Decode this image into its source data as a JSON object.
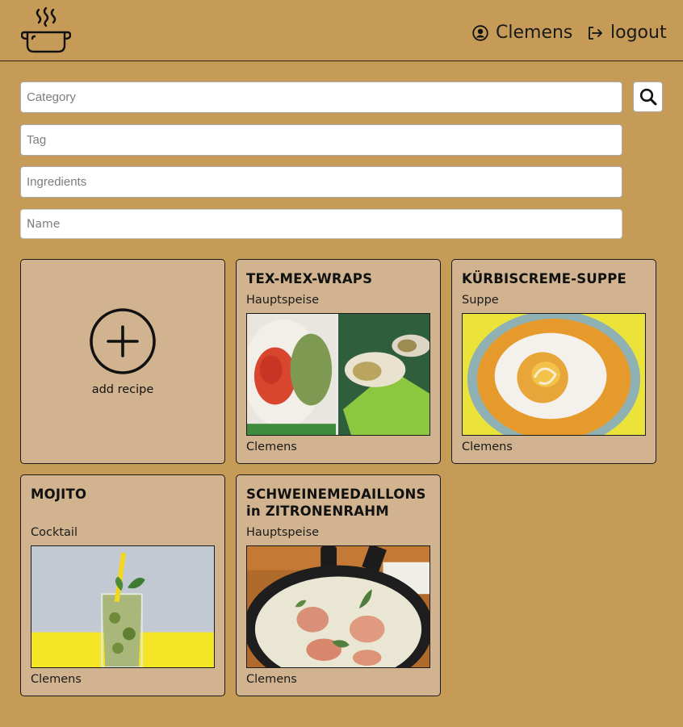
{
  "header": {
    "logo_icon": "cooking-pot-icon",
    "user_name": "Clemens",
    "user_icon": "user-circle-icon",
    "logout_label": "logout",
    "logout_icon": "logout-icon"
  },
  "filters": {
    "category_placeholder": "Category",
    "tag_placeholder": "Tag",
    "ingredients_placeholder": "Ingredients",
    "name_placeholder": "Name",
    "search_icon": "search-icon"
  },
  "add_recipe": {
    "label": "add recipe",
    "icon": "plus-circle-icon"
  },
  "recipes": [
    {
      "title": "TEX-MEX-WRAPS",
      "category": "Hauptspeise",
      "author": "Clemens"
    },
    {
      "title": "KÜRBISCREME-SUPPE",
      "category": "Suppe",
      "author": "Clemens"
    },
    {
      "title": "MOJITO",
      "category": "Cocktail",
      "author": "Clemens"
    },
    {
      "title": "SCHWEINEMEDAILLONS in ZITRONENRAHM",
      "category": "Hauptspeise",
      "author": "Clemens"
    }
  ],
  "colors": {
    "background": "#c69b58",
    "card": "#d1b48f",
    "border": "#1a1a1a"
  }
}
